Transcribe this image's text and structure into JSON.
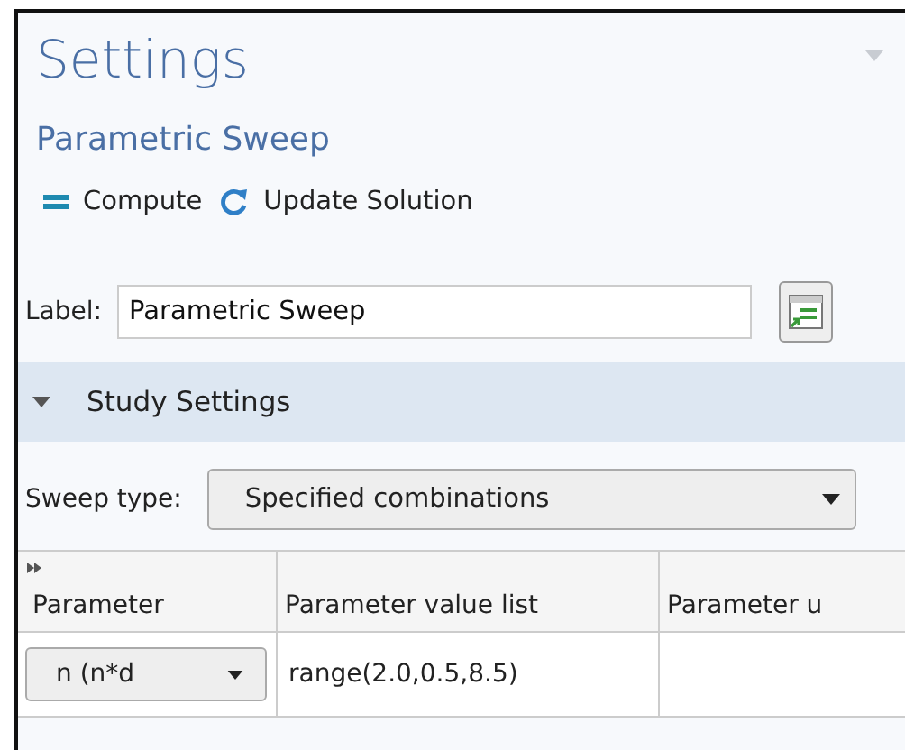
{
  "panel": {
    "title": "Settings",
    "subtitle": "Parametric Sweep"
  },
  "toolbar": [
    {
      "kind": "compute",
      "label": "Compute"
    },
    {
      "kind": "update",
      "label": "Update Solution"
    }
  ],
  "label_field": {
    "label": "Label:",
    "value": "Parametric Sweep"
  },
  "section": {
    "title": "Study Settings",
    "expanded": true
  },
  "sweep_type": {
    "label": "Sweep type:",
    "value": "Specified combinations"
  },
  "table": {
    "columns": [
      "Parameter",
      "Parameter value list",
      "Parameter u"
    ],
    "rows": [
      {
        "parameter": "n (n*d",
        "values": "range(2.0,0.5,8.5)"
      }
    ]
  }
}
